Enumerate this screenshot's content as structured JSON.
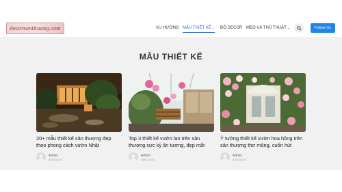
{
  "header": {
    "logo_text": "decorsanthuong.com",
    "nav": [
      {
        "label": "XU HƯỚNG",
        "active": false,
        "dropdown": false
      },
      {
        "label": "MẪU THIẾT KẾ",
        "active": true,
        "dropdown": true
      },
      {
        "label": "ĐỒ DECOR",
        "active": false,
        "dropdown": false
      },
      {
        "label": "MẸO VÀ THỦ THUẬT",
        "active": false,
        "dropdown": true
      }
    ],
    "search_icon": "search-icon",
    "follow_label": "Follow Us",
    "accent_color": "#1e86e6"
  },
  "main": {
    "section_title": "MẪU THIẾT KẾ",
    "posts": [
      {
        "title": "20+ mẫu thiết kế sân thượng đẹp theo phong cách vườn Nhật",
        "author": "Admin",
        "date": "05/01/2024"
      },
      {
        "title": "Top 3 thiết kế vườn lan trên sân thượng cực kỳ ấn tượng, đẹp mắt",
        "author": "Admin",
        "date": "04/01/2024"
      },
      {
        "title": "Ý tưởng thiết kế vườn hoa hồng trên sân thượng thơ mộng, cuốn hút",
        "author": "Admin",
        "date": "03/01/2024"
      }
    ]
  }
}
